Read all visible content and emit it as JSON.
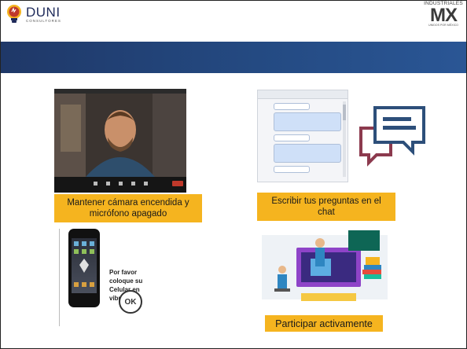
{
  "header": {
    "left_logo": {
      "name": "DUNI",
      "subtitle": "CONSULTORES"
    },
    "right_logo": {
      "top": "INDUSTRIALES",
      "main": "MX",
      "bottom": "UNIDOS POR MÉXICO"
    }
  },
  "colors": {
    "band": "#244a82",
    "caption_bg": "#f5b41f",
    "logo_navy": "#1e2a5a"
  },
  "panels": {
    "camera": {
      "caption_line1": "Mantener cámara encendida y",
      "caption_line2": "micrófono apagado"
    },
    "chat": {
      "caption_line1": "Escribir tus preguntas en el",
      "caption_line2": "chat"
    },
    "phone": {
      "text_line1": "Por favor coloque su",
      "text_line2": "Celular en vibrador!",
      "ok_label": "OK"
    },
    "participate": {
      "caption": "Participar activamente"
    }
  },
  "icons": [
    "lightbulb-logo-icon",
    "speech-bubbles-icon",
    "ok-hand-icon",
    "smartphone-icon"
  ]
}
